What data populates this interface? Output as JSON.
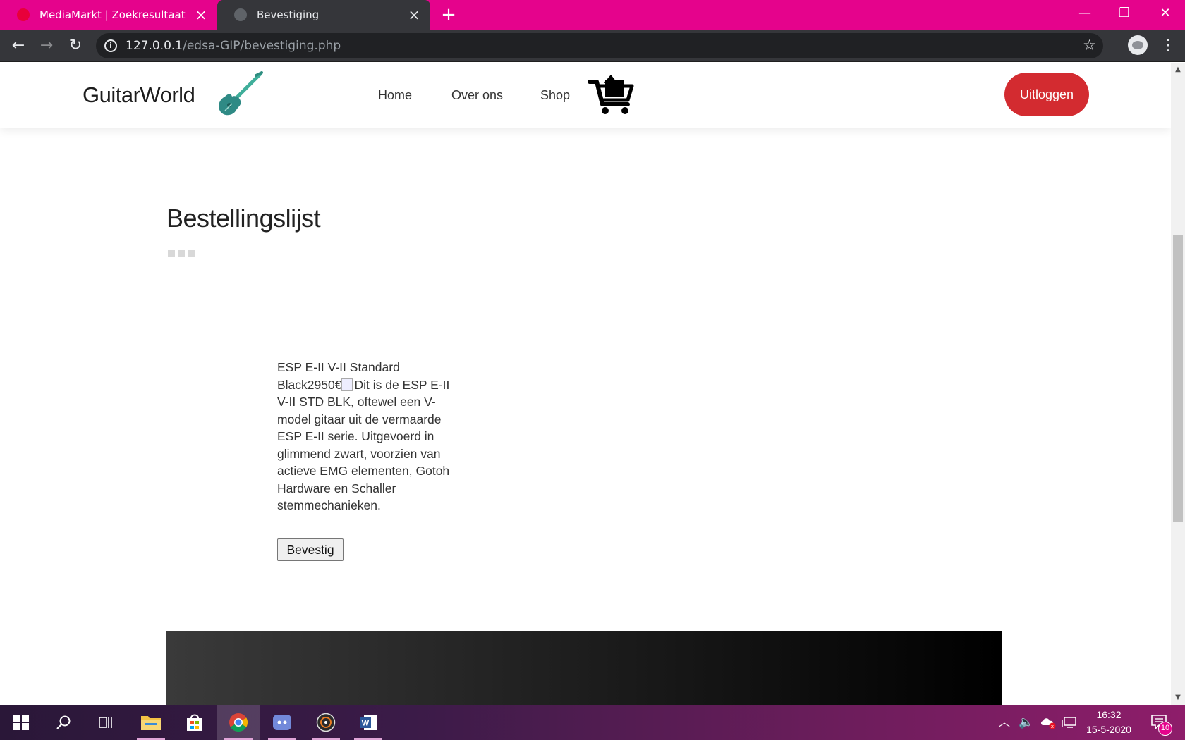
{
  "browser": {
    "tabs": [
      {
        "title": "MediaMarkt | Zoekresultaat",
        "active": false
      },
      {
        "title": "Bevestiging",
        "active": true
      }
    ],
    "url_host": "127.0.0.1",
    "url_path": "/edsa-GIP/bevestiging.php",
    "accent_color": "#e5038c"
  },
  "site": {
    "brand": "GuitarWorld",
    "nav": {
      "home": "Home",
      "about": "Over ons",
      "shop": "Shop"
    },
    "logout_label": "Uitloggen",
    "logout_color": "#d32b30"
  },
  "page": {
    "title": "Bestellingslijst",
    "product": {
      "name_price": "ESP E-II V-II Standard Black2950€",
      "img_alt": "Dit is de ESP E-II V-II STD BLK, oftewel een V-model gitaar uit de vermaarde ESP E-II serie. Uitgevoerd in glimmend zwart, voorzien van actieve EMG elementen, Gotoh Hardware en Schaller stemmechanieken."
    },
    "confirm_label": "Bevestig"
  },
  "taskbar": {
    "time": "16:32",
    "date": "15-5-2020",
    "notification_count": "10"
  }
}
